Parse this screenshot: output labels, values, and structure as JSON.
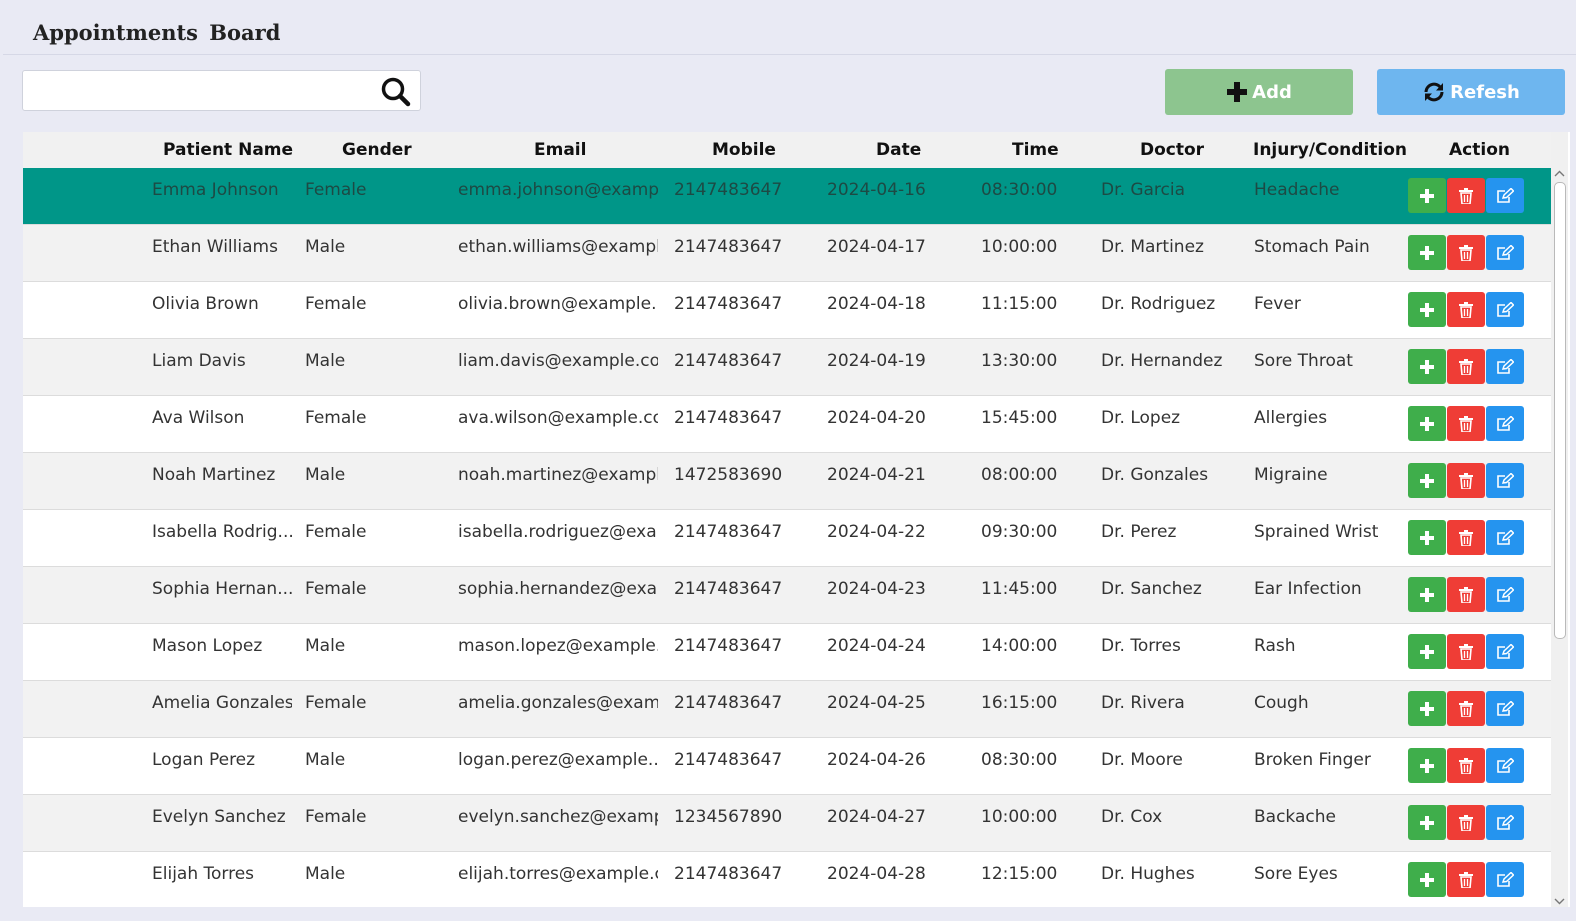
{
  "app": {
    "title": "Appointments  Board"
  },
  "search": {
    "value": "",
    "placeholder": ""
  },
  "toolbar": {
    "add_label": "Add",
    "refresh_label": "Refesh"
  },
  "colors": {
    "accent_add": "#8dc58f",
    "accent_refresh": "#6eb6ef",
    "selected_row": "#009688",
    "action_add": "#3fae4b",
    "action_delete": "#ef3d36",
    "action_edit": "#2594ef"
  },
  "table": {
    "columns": [
      "Patient Name",
      "Gender",
      "Email",
      "Mobile",
      "Date",
      "Time",
      "Doctor",
      "Injury/Condition",
      "Action"
    ],
    "selected_row": 0,
    "rows": [
      [
        "Emma Johnson",
        "Female",
        "emma.johnson@examp...",
        "2147483647",
        "2024-04-16",
        "08:30:00",
        "Dr. Garcia",
        "Headache"
      ],
      [
        "Ethan Williams",
        "Male",
        "ethan.williams@exampl...",
        "2147483647",
        "2024-04-17",
        "10:00:00",
        "Dr. Martinez",
        "Stomach Pain"
      ],
      [
        "Olivia Brown",
        "Female",
        "olivia.brown@example....",
        "2147483647",
        "2024-04-18",
        "11:15:00",
        "Dr. Rodriguez",
        "Fever"
      ],
      [
        "Liam Davis",
        "Male",
        "liam.davis@example.com",
        "2147483647",
        "2024-04-19",
        "13:30:00",
        "Dr. Hernandez",
        "Sore Throat"
      ],
      [
        "Ava Wilson",
        "Female",
        "ava.wilson@example.co...",
        "2147483647",
        "2024-04-20",
        "15:45:00",
        "Dr. Lopez",
        "Allergies"
      ],
      [
        "Noah Martinez",
        "Male",
        "noah.martinez@exampl...",
        "1472583690",
        "2024-04-21",
        "08:00:00",
        "Dr. Gonzales",
        "Migraine"
      ],
      [
        "Isabella Rodrig...",
        "Female",
        "isabella.rodriguez@exa...",
        "2147483647",
        "2024-04-22",
        "09:30:00",
        "Dr. Perez",
        "Sprained Wrist"
      ],
      [
        "Sophia Hernan...",
        "Female",
        "sophia.hernandez@exa...",
        "2147483647",
        "2024-04-23",
        "11:45:00",
        "Dr. Sanchez",
        "Ear Infection"
      ],
      [
        "Mason Lopez",
        "Male",
        "mason.lopez@example....",
        "2147483647",
        "2024-04-24",
        "14:00:00",
        "Dr. Torres",
        "Rash"
      ],
      [
        "Amelia Gonzales",
        "Female",
        "amelia.gonzales@exam...",
        "2147483647",
        "2024-04-25",
        "16:15:00",
        "Dr. Rivera",
        "Cough"
      ],
      [
        "Logan Perez",
        "Male",
        "logan.perez@example....",
        "2147483647",
        "2024-04-26",
        "08:30:00",
        "Dr. Moore",
        "Broken Finger"
      ],
      [
        "Evelyn Sanchez",
        "Female",
        "evelyn.sanchez@examp...",
        "1234567890",
        "2024-04-27",
        "10:00:00",
        "Dr. Cox",
        "Backache"
      ],
      [
        "Elijah Torres",
        "Male",
        "elijah.torres@example.c...",
        "2147483647",
        "2024-04-28",
        "12:15:00",
        "Dr. Hughes",
        "Sore Eyes"
      ]
    ]
  },
  "icons": {
    "search": "search-icon",
    "add": "plus-icon",
    "refresh": "refresh-icon",
    "row_add": "plus-icon",
    "row_delete": "trash-icon",
    "row_edit": "edit-icon"
  }
}
